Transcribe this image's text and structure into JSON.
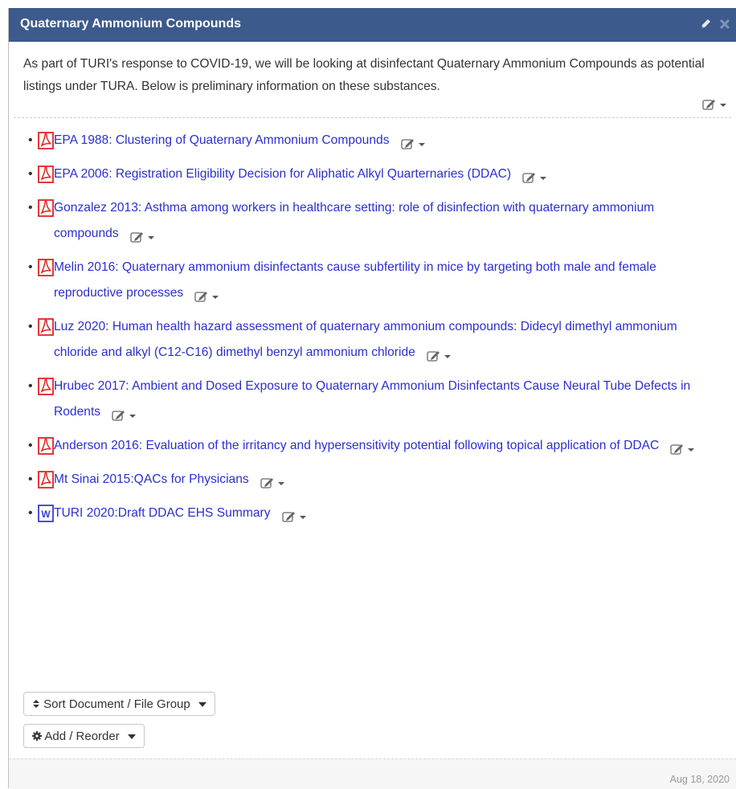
{
  "header": {
    "title": "Quaternary Ammonium Compounds"
  },
  "intro": {
    "text": "As part of TURI's response to COVID-19, we will be looking at disinfectant Quaternary Ammonium Compounds as potential listings under TURA. Below is preliminary information on these substances."
  },
  "documents": [
    {
      "label": "EPA 1988: Clustering of Quaternary Ammonium Compounds",
      "file_type": "pdf-icon"
    },
    {
      "label": "EPA 2006: Registration Eligibility Decision for Aliphatic Alkyl Quarternaries (DDAC)",
      "file_type": "pdf-icon"
    },
    {
      "label": "Gonzalez 2013: Asthma among workers in healthcare setting: role of disinfection with quaternary ammonium compounds",
      "file_type": "pdf-icon"
    },
    {
      "label": "Melin 2016: Quaternary ammonium disinfectants cause subfertility in mice by targeting both male and female reproductive processes",
      "file_type": "pdf-icon"
    },
    {
      "label": "Luz 2020: Human health hazard assessment of quaternary ammonium compounds: Didecyl dimethyl ammonium chloride and alkyl (C12-C16) dimethyl benzyl ammonium chloride",
      "file_type": "pdf-icon"
    },
    {
      "label": "Hrubec 2017: Ambient and Dosed Exposure to Quaternary Ammonium Disinfectants Cause Neural Tube Defects in Rodents",
      "file_type": "pdf-icon"
    },
    {
      "label": "Anderson 2016: Evaluation of the irritancy and hypersensitivity potential following topical application of DDAC",
      "file_type": "pdf-icon"
    },
    {
      "label": "Mt Sinai 2015:QACs for Physicians",
      "file_type": "pdf-icon"
    },
    {
      "label": "TURI 2020:Draft DDAC EHS Summary",
      "file_type": "word-icon"
    }
  ],
  "buttons": {
    "sort_label": "Sort Document / File Group",
    "add_label": "Add / Reorder"
  },
  "footer": {
    "date": "Aug 18, 2020"
  },
  "colors": {
    "header_bg": "#3c5a8c",
    "link": "#2b2fd0",
    "pdf_red": "#e02424",
    "word_blue": "#3b3bd6"
  }
}
